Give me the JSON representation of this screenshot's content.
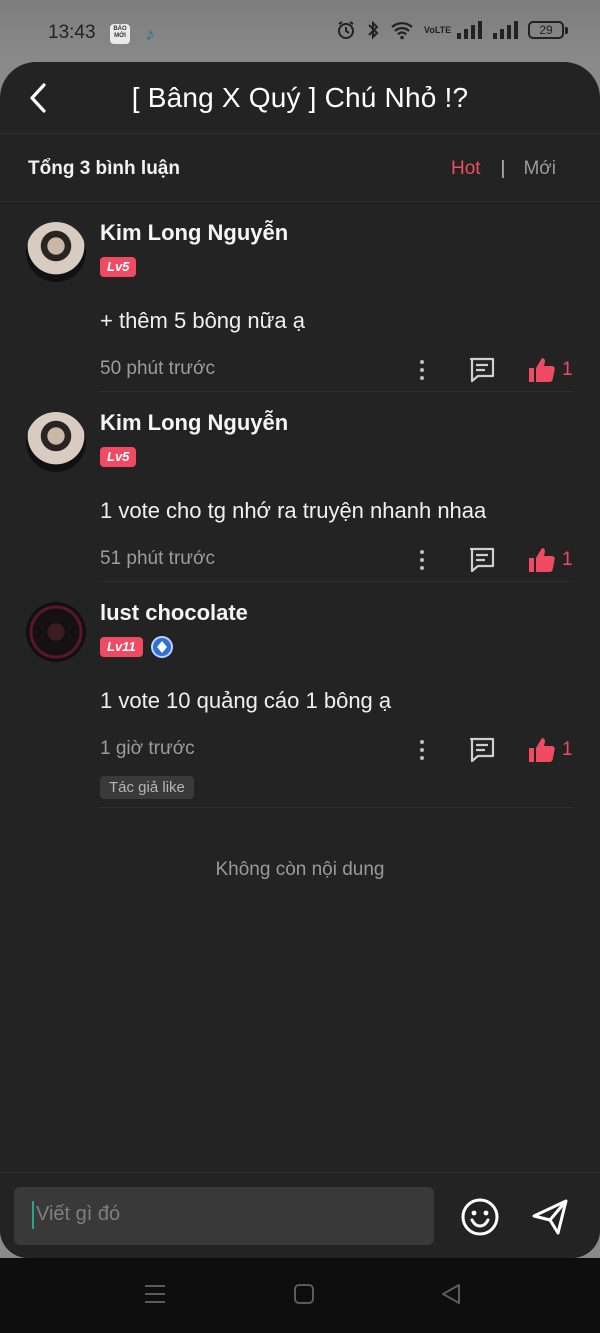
{
  "status_bar": {
    "time": "13:43",
    "app_icons": [
      "BÁO MỚI",
      "tiktok"
    ],
    "network": "VoLTE",
    "battery": "29"
  },
  "header": {
    "title": "[ Bâng X Quý ] Chú Nhỏ !?"
  },
  "subbar": {
    "total": "Tổng 3 bình luận",
    "sort_hot": "Hot",
    "sort_sep": "|",
    "sort_new": "Mới"
  },
  "comments": [
    {
      "name": "Kim Long Nguyễn",
      "level": "Lv5",
      "text": "+ thêm 5 bông nữa ạ",
      "time": "50 phút trước",
      "likes": "1"
    },
    {
      "name": "Kim Long Nguyễn",
      "level": "Lv5",
      "text": "1 vote cho tg nhớ ra truyện nhanh  nhaa",
      "time": "51 phút trước",
      "likes": "1"
    },
    {
      "name": "lust chocolate",
      "level": "Lv11",
      "text": "1 vote 10 quảng cáo 1 bông ạ",
      "time": "1 giờ trước",
      "likes": "1",
      "tag": "Tác giả like"
    }
  ],
  "end_text": "Không còn nội dung",
  "input": {
    "placeholder": "Viết gì đó"
  },
  "colors": {
    "accent": "#f04b63",
    "background": "#232323"
  }
}
